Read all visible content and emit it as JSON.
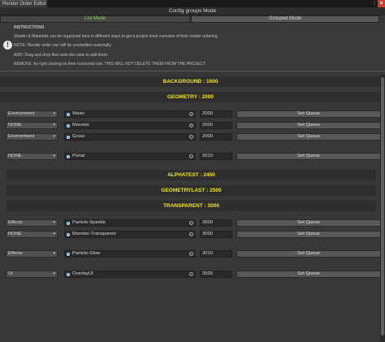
{
  "window": {
    "tab_title": "Render Order Editor",
    "close_glyph": "×",
    "menu_glyph": "⋮"
  },
  "header": {
    "title": "Config groups Mode"
  },
  "modes": {
    "list": "List Mode",
    "grouped": "Grouped Mode",
    "active": "list"
  },
  "info": {
    "instructions": "INSTRUCTIONS",
    "line1": "Shader & Materials can be organized here in different ways to get a project level overview of their render ordering",
    "note": "NOTE: Render order can still be overwritten externally",
    "add": "ADD: Drag and drop files onto this view to add them",
    "remove": "REMOVE: by right clicking on their horizontal slot. THIS WILL NOT DELETE THEM FROM THE PROJECT",
    "warn_glyph": "!"
  },
  "sections": {
    "background": "BACKGROUND : 1000",
    "geometry": "GEOMETRY : 2000",
    "alphatest": "ALPHATEST : 2450",
    "geometrylast": "GEOMETRYLAST : 2500",
    "transparent": "TRANSPARENT : 3000"
  },
  "set_queue_label": "Set Queue",
  "dropdown_arrow": "▾",
  "rows": [
    {
      "group": "Environment",
      "object": "Water",
      "queue": "2000"
    },
    {
      "group": "NONE",
      "object": "Monster",
      "queue": "2000"
    },
    {
      "group": "Environment",
      "object": "Grass",
      "queue": "2000"
    },
    {
      "group": "NONE",
      "object": "Portal",
      "queue": "2010"
    },
    {
      "group": "Effects",
      "object": "Particle-Sparkle",
      "queue": "3000"
    },
    {
      "group": "NONE",
      "object": "Monster-Transparent",
      "queue": "3000"
    },
    {
      "group": "Effects",
      "object": "Particle-Glow",
      "queue": "3010"
    },
    {
      "group": "UI",
      "object": "OverlayUI",
      "queue": "3500"
    }
  ],
  "colors": {
    "accent_green": "#7ed957",
    "section_yellow": "#f2e70d",
    "close_red": "#d23a2e"
  }
}
